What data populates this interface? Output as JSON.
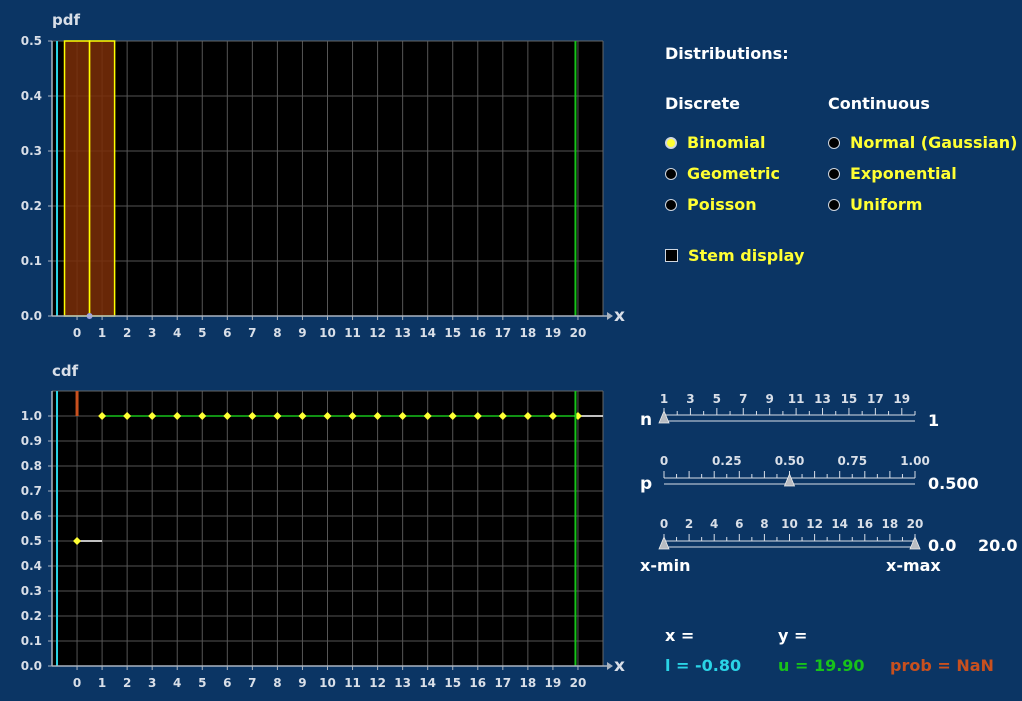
{
  "pdf": {
    "title": "pdf",
    "ylim": [
      0,
      0.5
    ],
    "yticks": [
      "0.0",
      "0.1",
      "0.2",
      "0.3",
      "0.4",
      "0.5"
    ],
    "xlabel": "x"
  },
  "cdf": {
    "title": "cdf",
    "ylim": [
      0,
      1.1
    ],
    "yticks": [
      "0.0",
      "0.1",
      "0.2",
      "0.3",
      "0.4",
      "0.5",
      "0.6",
      "0.7",
      "0.8",
      "0.9",
      "1.0"
    ],
    "xlabel": "x"
  },
  "chart_data": [
    {
      "type": "bar",
      "title": "pdf",
      "xlabel": "x",
      "ylabel": "",
      "xlim": [
        -1,
        21
      ],
      "ylim": [
        0,
        0.5
      ],
      "x": [
        0,
        1
      ],
      "values": [
        0.5,
        0.5
      ],
      "xticks": [
        0,
        1,
        2,
        3,
        4,
        5,
        6,
        7,
        8,
        9,
        10,
        11,
        12,
        13,
        14,
        15,
        16,
        17,
        18,
        19,
        20
      ],
      "grid": true
    },
    {
      "type": "line",
      "title": "cdf",
      "xlabel": "x",
      "ylabel": "",
      "xlim": [
        -1,
        21
      ],
      "ylim": [
        0,
        1.1
      ],
      "x": [
        0,
        1,
        2,
        3,
        4,
        5,
        6,
        7,
        8,
        9,
        10,
        11,
        12,
        13,
        14,
        15,
        16,
        17,
        18,
        19,
        20
      ],
      "values": [
        0.5,
        1,
        1,
        1,
        1,
        1,
        1,
        1,
        1,
        1,
        1,
        1,
        1,
        1,
        1,
        1,
        1,
        1,
        1,
        1,
        1
      ],
      "xticks": [
        0,
        1,
        2,
        3,
        4,
        5,
        6,
        7,
        8,
        9,
        10,
        11,
        12,
        13,
        14,
        15,
        16,
        17,
        18,
        19,
        20
      ],
      "grid": true
    }
  ],
  "markers": {
    "lower": -0.8,
    "upper": 19.9,
    "cyan_color": "#2ad4e6",
    "green_color": "#17c21a",
    "prob_color": "#c8501e"
  },
  "distributions": {
    "heading": "Distributions:",
    "discrete_heading": "Discrete",
    "continuous_heading": "Continuous",
    "discrete": [
      {
        "label": "Binomial",
        "selected": true
      },
      {
        "label": "Geometric",
        "selected": false
      },
      {
        "label": "Poisson",
        "selected": false
      }
    ],
    "continuous": [
      {
        "label": "Normal (Gaussian)",
        "selected": false
      },
      {
        "label": "Exponential",
        "selected": false
      },
      {
        "label": "Uniform",
        "selected": false
      }
    ],
    "stem_display": {
      "label": "Stem display",
      "checked": false
    }
  },
  "sliders": {
    "n": {
      "name": "n",
      "ticks": [
        "1",
        "3",
        "5",
        "7",
        "9",
        "11",
        "13",
        "15",
        "17",
        "19"
      ],
      "value": "1",
      "min": 1,
      "max": 20,
      "current": 1
    },
    "p": {
      "name": "p",
      "ticks": [
        "0",
        "0.25",
        "0.50",
        "0.75",
        "1.00"
      ],
      "value": "0.500",
      "min": 0,
      "max": 1,
      "current": 0.5
    },
    "range": {
      "ticks": [
        "0",
        "2",
        "4",
        "6",
        "8",
        "10",
        "12",
        "14",
        "16",
        "18",
        "20"
      ],
      "min_label": "x-min",
      "max_label": "x-max",
      "min_value": "0.0",
      "max_value": "20.0",
      "min": 0,
      "max": 20,
      "current_min": 0,
      "current_max": 20
    }
  },
  "readouts": {
    "x_label": "x =",
    "y_label": "y =",
    "l_text": "l = -0.80",
    "u_text": "u = 19.90",
    "prob_text": "prob = NaN"
  }
}
